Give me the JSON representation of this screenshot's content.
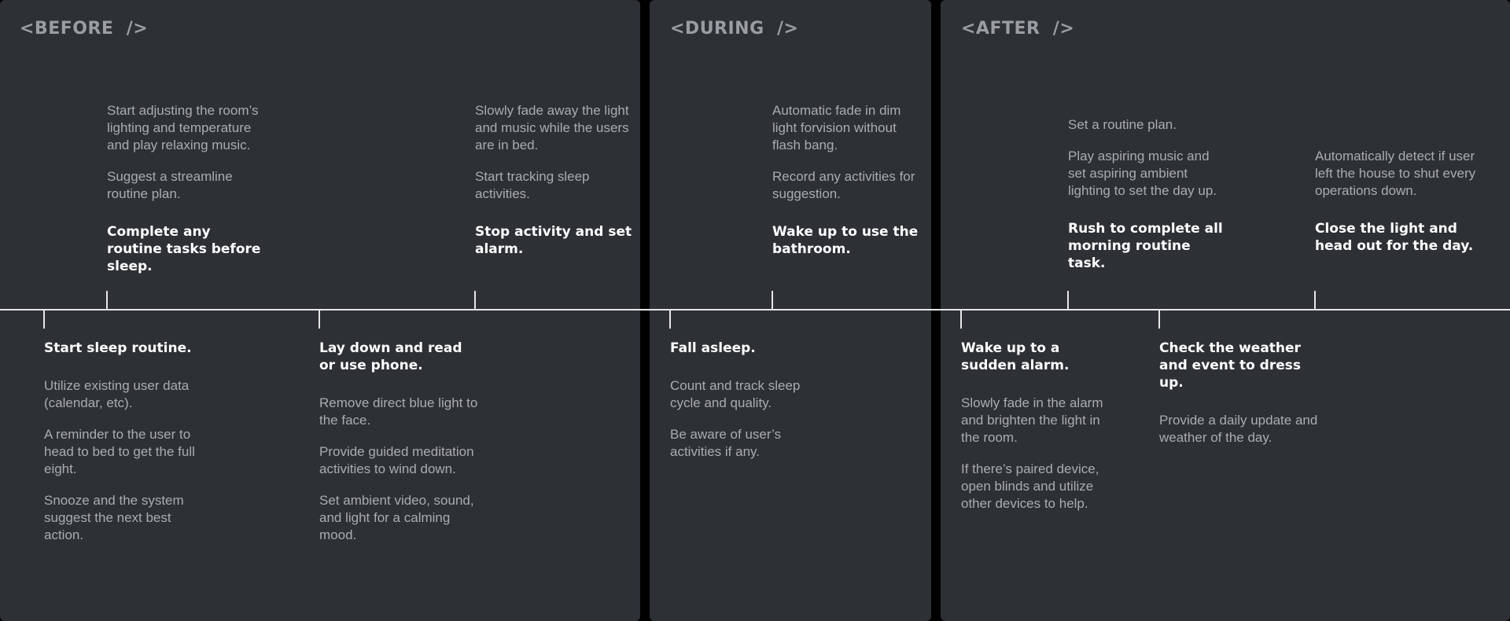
{
  "phases": [
    {
      "title": "<BEFORE  />"
    },
    {
      "title": "<DURING  />"
    },
    {
      "title": "<AFTER  />"
    }
  ],
  "steps_above": [
    {
      "lines": [
        "Start adjusting the room’s lighting and temperature and play relaxing music.",
        "Suggest  a streamline routine plan."
      ],
      "title": "Complete any routine tasks before sleep."
    },
    {
      "lines": [
        "Slowly fade away the light and music while the users are in bed.",
        "Start tracking sleep activities."
      ],
      "title": "Stop activity and set alarm."
    },
    {
      "lines": [
        "Automatic fade in dim light forvision without flash bang.",
        "Record any activities for suggestion."
      ],
      "title": "Wake up to use the bathroom."
    },
    {
      "lines": [
        "Set a routine plan.",
        "Play aspiring music and set aspiring ambient lighting to set the day up."
      ],
      "title": "Rush to complete all morning routine task."
    },
    {
      "lines": [
        "Automatically detect if user left the house to shut every operations down."
      ],
      "title": "Close the light and head out for the day."
    }
  ],
  "steps_below": [
    {
      "title": "Start sleep routine.",
      "lines": [
        "Utilize existing user data (calendar, etc).",
        "A reminder to the user to head to bed to get the full eight.",
        "Snooze and the system suggest the next best action."
      ]
    },
    {
      "title": "Lay down and read or use phone.",
      "lines": [
        "Remove direct blue light to the face.",
        "Provide guided meditation activities to wind down.",
        "Set ambient video, sound, and light for a calming mood."
      ]
    },
    {
      "title": "Fall asleep.",
      "lines": [
        "Count and track sleep cycle and quality.",
        "Be aware of user’s activities if any."
      ]
    },
    {
      "title": "Wake up to a sudden alarm.",
      "lines": [
        "Slowly fade in the alarm and brighten the light in the room.",
        "If there’s paired device, open blinds and utilize other devices to help."
      ]
    },
    {
      "title": "Check the weather and event to dress up.",
      "lines": [
        "Provide a daily update and weather of the day."
      ]
    }
  ],
  "colors": {
    "panel": "#2d3035",
    "line": "#e6e6e6",
    "muted": "#a9acb0",
    "heading": "#ffffff"
  }
}
